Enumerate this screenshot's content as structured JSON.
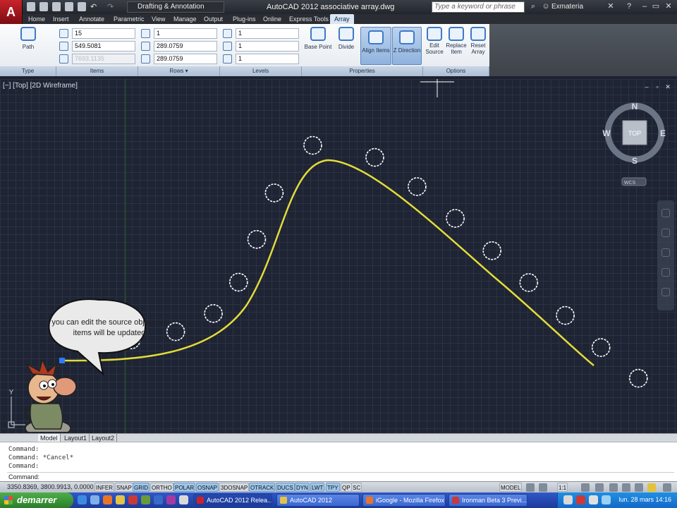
{
  "window": {
    "title": "AutoCAD 2012   associative array.dwg",
    "workspace": "Drafting & Annotation",
    "search_placeholder": "Type a keyword or phrase",
    "user": "Exmateria"
  },
  "ribbon_tabs": [
    "Home",
    "Insert",
    "Annotate",
    "Parametric",
    "View",
    "Manage",
    "Output",
    "Plug-ins",
    "Online",
    "Express Tools",
    "Array"
  ],
  "ribbon": {
    "type_panel": {
      "title": "Type",
      "path_label": "Path"
    },
    "items_panel": {
      "title": "Items",
      "count": "15",
      "spacing": "549.5081",
      "total": "7693.1135"
    },
    "rows_panel": {
      "title": "Rows",
      "count": "1",
      "spacing": "289.0759",
      "total": "289.0759"
    },
    "levels_panel": {
      "title": "Levels",
      "count": "1",
      "spacing": "1",
      "total": "1"
    },
    "properties_panel": {
      "title": "Properties",
      "base_point": "Base Point",
      "divide": "Divide",
      "align_items": "Align Items",
      "z_direction": "Z Direction"
    },
    "options_panel": {
      "title": "Options",
      "edit_source_1": "Edit",
      "edit_source_2": "Source",
      "replace_item_1": "Replace",
      "replace_item_2": "Item",
      "reset_array_1": "Reset",
      "reset_array_2": "Array"
    }
  },
  "viewport": {
    "label": "[−] [Top] [2D Wireframe]",
    "compass": {
      "n": "N",
      "s": "S",
      "e": "E",
      "w": "W",
      "top": "TOP",
      "wcs": "WCS"
    },
    "speech": "you can edit the source object, all items will be updated",
    "y_axis": "Y",
    "colors": {
      "path": "#e3dc3a",
      "items": "#ffffff",
      "grip": "#2e7bff"
    }
  },
  "layout_tabs": [
    "Model",
    "Layout1",
    "Layout2"
  ],
  "command_history": [
    "Command:",
    "Command: *Cancel*",
    "Command:"
  ],
  "command_prompt": "Command:",
  "statusbar": {
    "coords": "3350.8369, 3800.9913, 0.0000",
    "toggles": [
      {
        "label": "INFER",
        "on": false
      },
      {
        "label": "SNAP",
        "on": false
      },
      {
        "label": "GRID",
        "on": true
      },
      {
        "label": "ORTHO",
        "on": false
      },
      {
        "label": "POLAR",
        "on": true
      },
      {
        "label": "OSNAP",
        "on": true
      },
      {
        "label": "3DOSNAP",
        "on": false
      },
      {
        "label": "OTRACK",
        "on": true
      },
      {
        "label": "DUCS",
        "on": true
      },
      {
        "label": "DYN",
        "on": true
      },
      {
        "label": "LWT",
        "on": true
      },
      {
        "label": "TPY",
        "on": true
      },
      {
        "label": "QP",
        "on": false
      },
      {
        "label": "SC",
        "on": false
      }
    ],
    "model": "MODEL",
    "scale": "1:1"
  },
  "taskbar": {
    "start": "demarrer",
    "tasks": [
      "AutoCAD 2012 Relea...",
      "AutoCAD 2012",
      "iGoogle - Mozilla Firefox",
      "Ironman Beta 3 Previ..."
    ],
    "clock": "lun. 28 mars 14:16"
  }
}
